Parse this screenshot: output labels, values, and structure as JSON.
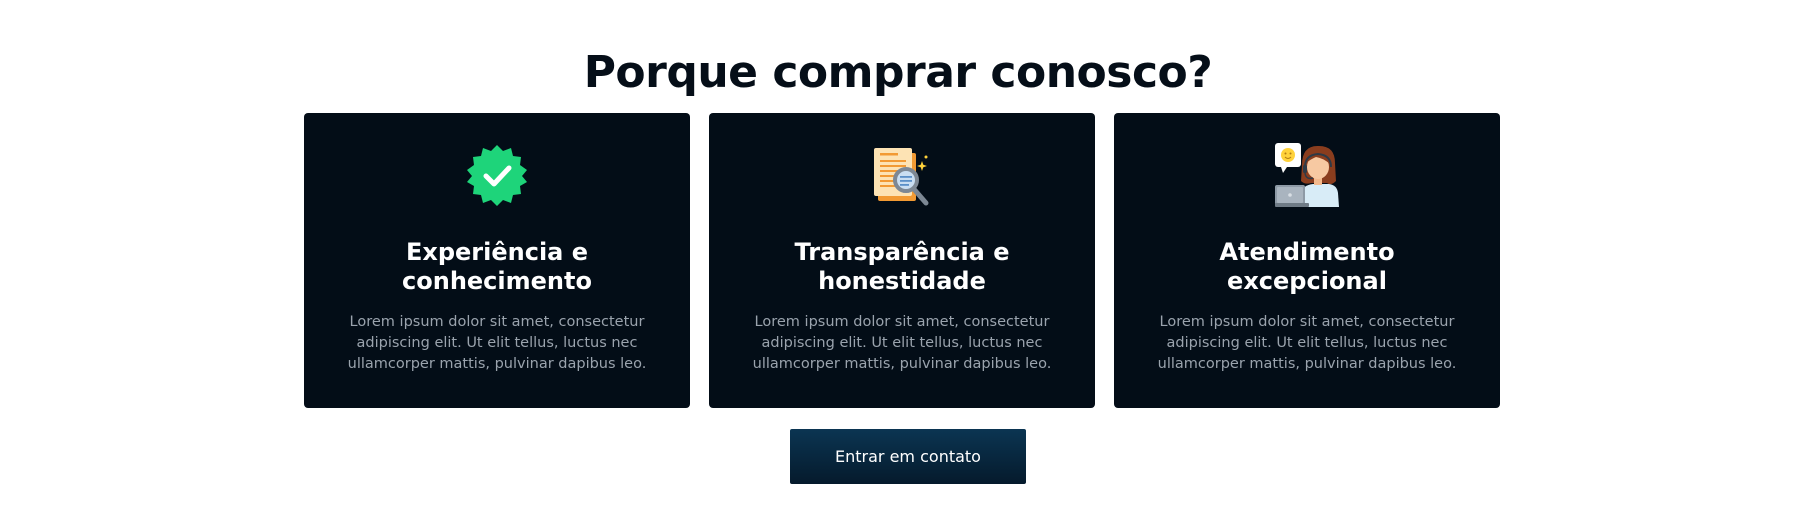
{
  "section": {
    "title": "Porque comprar conosco?"
  },
  "cards": [
    {
      "icon": "verified-badge-icon",
      "title_line1": "Experiência e",
      "title_line2": "conhecimento",
      "description": "Lorem ipsum dolor sit amet, consectetur adipiscing elit. Ut elit tellus, luctus nec ullamcorper mattis, pulvinar dapibus leo."
    },
    {
      "icon": "document-search-icon",
      "title_line1": "Transparência e",
      "title_line2": "honestidade",
      "description": "Lorem ipsum dolor sit amet, consectetur adipiscing elit. Ut elit tellus, luctus nec ullamcorper mattis, pulvinar dapibus leo."
    },
    {
      "icon": "customer-support-icon",
      "title_line1": "Atendimento",
      "title_line2": "excepcional",
      "description": "Lorem ipsum dolor sit amet, consectetur adipiscing elit. Ut elit tellus, luctus nec ullamcorper mattis, pulvinar dapibus leo."
    }
  ],
  "cta": {
    "label": "Entrar em contato"
  },
  "colors": {
    "card_background": "#030d17",
    "title": "#050e18",
    "description": "#9aa3ad",
    "badge_green": "#1ed47a"
  }
}
